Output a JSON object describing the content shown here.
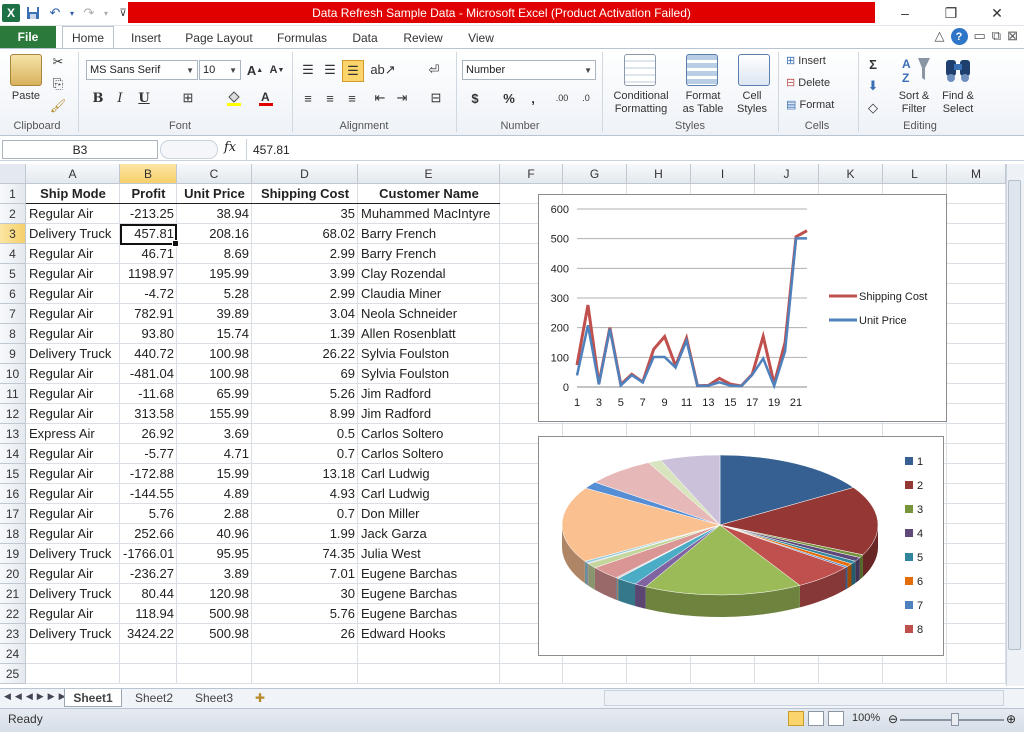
{
  "window": {
    "title": "Data Refresh Sample Data - Microsoft Excel (Product Activation Failed)"
  },
  "ribbon_tabs": [
    "File",
    "Home",
    "Insert",
    "Page Layout",
    "Formulas",
    "Data",
    "Review",
    "View"
  ],
  "ribbon": {
    "clipboard": {
      "label": "Clipboard",
      "paste": "Paste"
    },
    "font": {
      "label": "Font",
      "name": "MS Sans Serif",
      "size": "10",
      "bold": "B",
      "italic": "I",
      "underline": "U"
    },
    "alignment": {
      "label": "Alignment"
    },
    "number": {
      "label": "Number",
      "format": "Number",
      "currency": "$",
      "percent": "%",
      "comma": ","
    },
    "styles": {
      "label": "Styles",
      "conditional": "Conditional",
      "conditional2": "Formatting",
      "format_table": "Format",
      "format_table2": "as Table",
      "cell_styles": "Cell",
      "cell_styles2": "Styles"
    },
    "cells": {
      "label": "Cells",
      "insert": "Insert",
      "delete": "Delete",
      "format": "Format"
    },
    "editing": {
      "label": "Editing",
      "sigma": "Σ",
      "sort": "Sort &",
      "sort2": "Filter",
      "find": "Find &",
      "find2": "Select"
    }
  },
  "formula_bar": {
    "name_box": "B3",
    "fx": "fx",
    "value": "457.81"
  },
  "columns": [
    "A",
    "B",
    "C",
    "D",
    "E",
    "F",
    "G",
    "H",
    "I",
    "J",
    "K",
    "L",
    "M"
  ],
  "rows": [
    "1",
    "2",
    "3",
    "4",
    "5",
    "6",
    "7",
    "8",
    "9",
    "10",
    "11",
    "12",
    "13",
    "14",
    "15",
    "16",
    "17",
    "18",
    "19",
    "20",
    "21",
    "22",
    "23",
    "24",
    "25"
  ],
  "table": {
    "headers": [
      "Ship Mode",
      "Profit",
      "Unit Price",
      "Shipping Cost",
      "Customer Name"
    ],
    "data": [
      [
        "Regular Air",
        "-213.25",
        "38.94",
        "35",
        "Muhammed MacIntyre"
      ],
      [
        "Delivery Truck",
        "457.81",
        "208.16",
        "68.02",
        "Barry French"
      ],
      [
        "Regular Air",
        "46.71",
        "8.69",
        "2.99",
        "Barry French"
      ],
      [
        "Regular Air",
        "1198.97",
        "195.99",
        "3.99",
        "Clay Rozendal"
      ],
      [
        "Regular Air",
        "-4.72",
        "5.28",
        "2.99",
        "Claudia Miner"
      ],
      [
        "Regular Air",
        "782.91",
        "39.89",
        "3.04",
        "Neola Schneider"
      ],
      [
        "Regular Air",
        "93.80",
        "15.74",
        "1.39",
        "Allen Rosenblatt"
      ],
      [
        "Delivery Truck",
        "440.72",
        "100.98",
        "26.22",
        "Sylvia Foulston"
      ],
      [
        "Regular Air",
        "-481.04",
        "100.98",
        "69",
        "Sylvia Foulston"
      ],
      [
        "Regular Air",
        "-11.68",
        "65.99",
        "5.26",
        "Jim Radford"
      ],
      [
        "Regular Air",
        "313.58",
        "155.99",
        "8.99",
        "Jim Radford"
      ],
      [
        "Express Air",
        "26.92",
        "3.69",
        "0.5",
        "Carlos Soltero"
      ],
      [
        "Regular Air",
        "-5.77",
        "4.71",
        "0.7",
        "Carlos Soltero"
      ],
      [
        "Regular Air",
        "-172.88",
        "15.99",
        "13.18",
        "Carl Ludwig"
      ],
      [
        "Regular Air",
        "-144.55",
        "4.89",
        "4.93",
        "Carl Ludwig"
      ],
      [
        "Regular Air",
        "5.76",
        "2.88",
        "0.7",
        "Don Miller"
      ],
      [
        "Regular Air",
        "252.66",
        "40.96",
        "1.99",
        "Jack Garza"
      ],
      [
        "Delivery Truck",
        "-1766.01",
        "95.95",
        "74.35",
        "Julia West"
      ],
      [
        "Regular Air",
        "-236.27",
        "3.89",
        "7.01",
        "Eugene Barchas"
      ],
      [
        "Delivery Truck",
        "80.44",
        "120.98",
        "30",
        "Eugene Barchas"
      ],
      [
        "Regular Air",
        "118.94",
        "500.98",
        "5.76",
        "Eugene Barchas"
      ],
      [
        "Delivery Truck",
        "3424.22",
        "500.98",
        "26",
        "Edward Hooks"
      ]
    ]
  },
  "chart_data": [
    {
      "type": "line",
      "x": [
        1,
        2,
        3,
        4,
        5,
        6,
        7,
        8,
        9,
        10,
        11,
        12,
        13,
        14,
        15,
        16,
        17,
        18,
        19,
        20,
        21,
        22
      ],
      "xticks": [
        "1",
        "3",
        "5",
        "7",
        "9",
        "11",
        "13",
        "15",
        "17",
        "19",
        "21"
      ],
      "ylim": [
        0,
        600
      ],
      "yticks": [
        "0",
        "100",
        "200",
        "300",
        "400",
        "500",
        "600"
      ],
      "series": [
        {
          "name": "Shipping Cost",
          "color": "#c0504d",
          "values": [
            35,
            68.02,
            2.99,
            3.99,
            2.99,
            3.04,
            1.39,
            26.22,
            69,
            5.26,
            8.99,
            0.5,
            0.7,
            13.18,
            4.93,
            0.7,
            1.99,
            74.35,
            7.01,
            30,
            5.76,
            26
          ]
        },
        {
          "name": "Unit Price",
          "color": "#4f81bd",
          "values": [
            38.94,
            208.16,
            8.69,
            195.99,
            5.28,
            39.89,
            15.74,
            100.98,
            100.98,
            65.99,
            155.99,
            3.69,
            4.71,
            15.99,
            4.89,
            2.88,
            40.96,
            95.95,
            3.89,
            120.98,
            500.98,
            500.98
          ]
        }
      ],
      "legend": "right"
    },
    {
      "type": "pie",
      "legend": "right",
      "legend_entries": [
        "1",
        "2",
        "3",
        "4",
        "5",
        "6",
        "7",
        "8"
      ],
      "colors": [
        "#376092",
        "#953735",
        "#77933c",
        "#5f497a",
        "#31859c",
        "#e46c0a",
        "#4f81bd",
        "#c0504d",
        "#9bbb59",
        "#8064a2",
        "#4bacc6",
        "#f79646",
        "#95b3d7",
        "#d99694",
        "#c3d69b",
        "#b3a2c7",
        "#93cddd",
        "#fac090",
        "#558ed5",
        "#e6b9b8",
        "#d7e4bd",
        "#ccc1da"
      ],
      "values": [
        68.02,
        68.02,
        2.99,
        3.99,
        2.99,
        3.04,
        1.39,
        26.22,
        69,
        5.26,
        8.99,
        0.5,
        0.7,
        13.18,
        4.93,
        0.7,
        1.99,
        74.35,
        7.01,
        30,
        5.76,
        26
      ]
    }
  ],
  "sheets": [
    "Sheet1",
    "Sheet2",
    "Sheet3"
  ],
  "status": {
    "text": "Ready",
    "zoom": "100%"
  }
}
